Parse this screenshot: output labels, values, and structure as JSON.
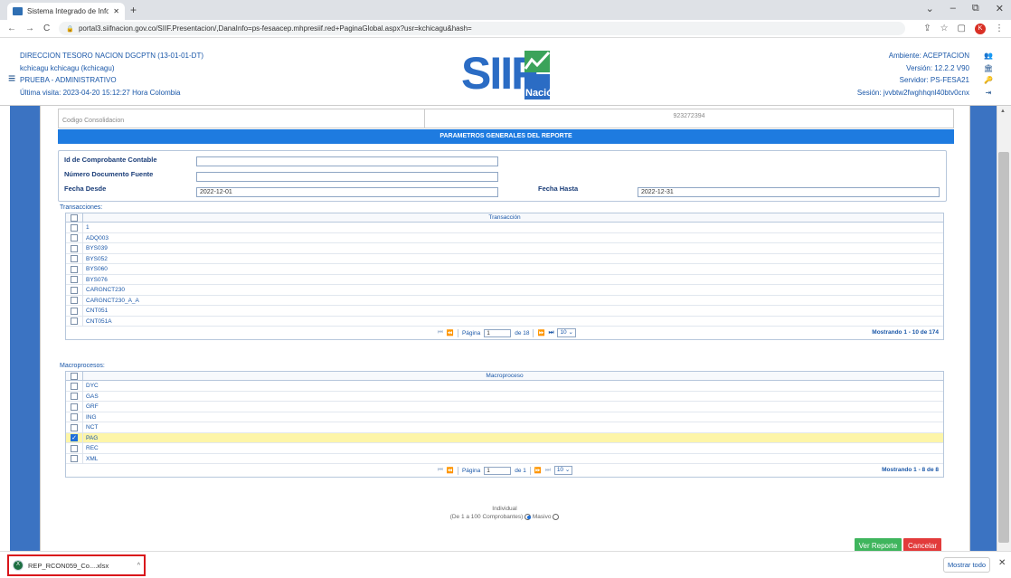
{
  "browser": {
    "tab_title": "Sistema Integrado de Información",
    "new_tab": "+",
    "url": "portal3.siifnacion.gov.co/SIIF.Presentacion/,DanaInfo=ps-fesaacep.mhpresiif.red+PaginaGlobal.aspx?usr=kchicagu&hash=",
    "profile_initial": "K",
    "window_controls": [
      "⌄",
      "–",
      "⧉",
      "✕"
    ]
  },
  "header": {
    "entity": "DIRECCION TESORO NACION DGCPTN (13-01-01-DT)",
    "user": "kchicagu kchicagu (kchicagu)",
    "profile": "PRUEBA - ADMINISTRATIVO",
    "last_visit": "Última visita: 2023-04-20 15:12:27 Hora Colombia",
    "environment": "Ambiente: ACEPTACION",
    "version": "Versión: 12.2.2 V90",
    "server": "Servidor: PS-FESA21",
    "session": "Sesión: jvvbtw2fwghhqnl40btv0cnx",
    "logo_text": "SIIF",
    "logo_sub": "Nación"
  },
  "consolidation": {
    "label": "Codigo Consolidacion",
    "value": "923272394"
  },
  "section_title": "PARAMETROS GENERALES DEL REPORTE",
  "filters": {
    "comprobante_label": "Id de Comprobante Contable",
    "comprobante_value": "",
    "documento_label": "Número Documento Fuente",
    "documento_value": "",
    "fecha_desde_label": "Fecha Desde",
    "fecha_desde_value": "2022-12-01",
    "fecha_hasta_label": "Fecha Hasta",
    "fecha_hasta_value": "2022-12-31"
  },
  "transacciones": {
    "label": "Transacciones:",
    "column": "Transacción",
    "rows": [
      "1",
      "ADQ003",
      "BYS039",
      "BYS052",
      "BYS060",
      "BYS076",
      "CARGNCT230",
      "CARGNCT230_A_A",
      "CNT051",
      "CNT051A"
    ],
    "page_label": "Página",
    "page": "1",
    "of_label": "de 18",
    "page_size": "10",
    "showing": "Mostrando 1 - 10 de 174"
  },
  "macroprocesos": {
    "label": "Macroprocesos:",
    "column": "Macroproceso",
    "rows": [
      "DYC",
      "GAS",
      "GRF",
      "ING",
      "NCT",
      "PAG",
      "REC",
      "XML"
    ],
    "selected_index": 5,
    "page_label": "Página",
    "page": "1",
    "of_label": "de 1",
    "page_size": "10",
    "showing": "Mostrando 1 - 8 de 8"
  },
  "mode": {
    "individual": "Individual",
    "range": "(De 1 a 100 Comprobantes)",
    "masivo": "Masivo",
    "selected": "individual"
  },
  "buttons": {
    "ver_reporte": "Ver Reporte",
    "cancelar": "Cancelar"
  },
  "download": {
    "filename": "REP_RCON059_Co....xlsx",
    "show_all": "Mostrar todo"
  },
  "colors": {
    "accent_blue": "#1e7be0",
    "side_band": "#3b73c2",
    "selected_row": "#fdf5a8",
    "ver_reporte": "#3fb55d",
    "cancelar": "#e23b3b"
  }
}
